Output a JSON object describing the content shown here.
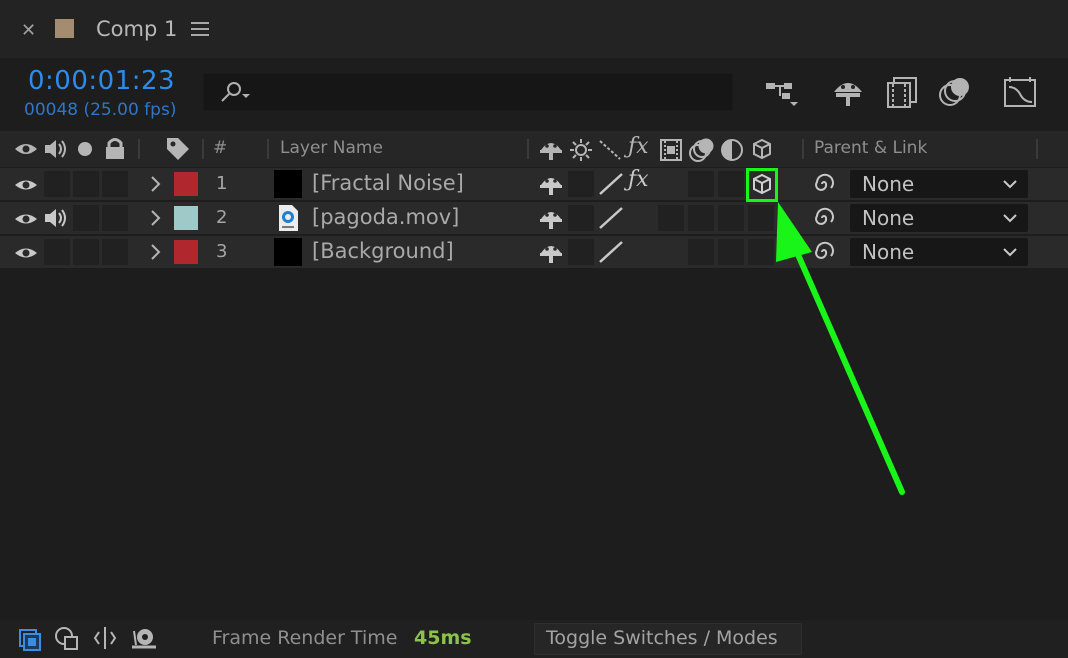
{
  "panel": {
    "tab_title": "Comp 1",
    "comp_color": "#a48c70",
    "timecode": "0:00:01:23",
    "frame_info": "00048 (25.00 fps)"
  },
  "header": {
    "hash": "#",
    "layer_name": "Layer Name",
    "parent_link": "Parent & Link"
  },
  "layers": [
    {
      "num": "1",
      "label_color": "#b0282e",
      "thumb": "solid-black",
      "name": "[Fractal Noise]",
      "has_audio": false,
      "has_fx": true,
      "parent": "None"
    },
    {
      "num": "2",
      "label_color": "#9fc9c8",
      "thumb": "movie-file-icon",
      "name": "[pagoda.mov]",
      "has_audio": true,
      "has_fx": false,
      "parent": "None"
    },
    {
      "num": "3",
      "label_color": "#b0282e",
      "thumb": "solid-black",
      "name": "[Background]",
      "has_audio": false,
      "has_fx": false,
      "parent": "None"
    }
  ],
  "footer": {
    "render_label": "Frame Render Time",
    "render_value": "45ms",
    "toggle_label": "Toggle Switches / Modes"
  },
  "colors": {
    "accent_timecode": "#2d8ceb",
    "render_value": "#8bc34a",
    "annotation": "#19f519"
  }
}
